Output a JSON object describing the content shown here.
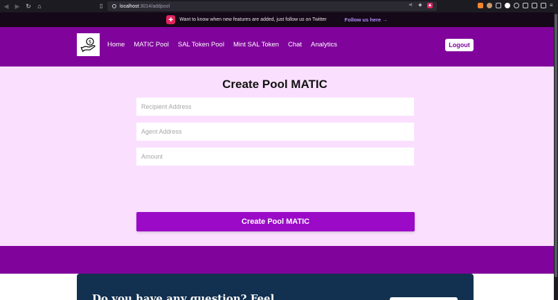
{
  "browser": {
    "url_host": "localhost",
    "url_path": ":3014/addpool"
  },
  "announcement": {
    "text": "Want to know when new features are added, just follow us on Twitter",
    "link": "Follow us here →"
  },
  "header": {
    "nav": [
      "Home",
      "MATIC Pool",
      "SAL Token Pool",
      "Mint SAL Token",
      "Chat",
      "Analytics"
    ],
    "logout": "Logout"
  },
  "form": {
    "title": "Create Pool MATIC",
    "recipient_placeholder": "Recipient Address",
    "agent_placeholder": "Agent Address",
    "amount_placeholder": "Amount",
    "submit_label": "Create Pool MATIC"
  },
  "footer": {
    "cta_text": "Do you have any question? Feel"
  },
  "colors": {
    "header_purple": "#80049b",
    "button_purple": "#9b0bc7",
    "page_bg": "#fae0fe",
    "cta_navy": "#12304f"
  }
}
